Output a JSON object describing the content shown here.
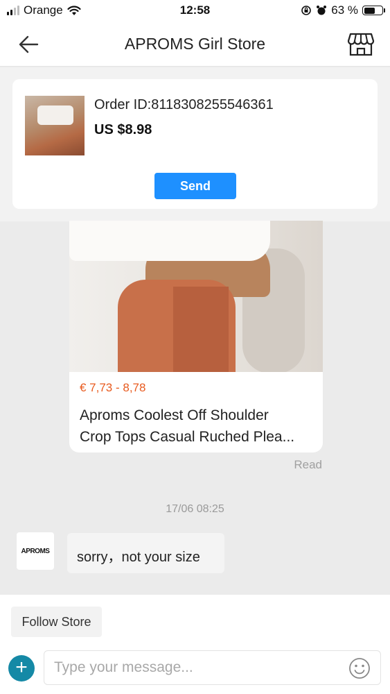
{
  "status_bar": {
    "carrier": "Orange",
    "time": "12:58",
    "battery": "63 %",
    "battery_level": 0.63,
    "icons": [
      "signal-icon",
      "wifi-icon",
      "rotation-lock-icon",
      "alarm-icon",
      "battery-icon"
    ]
  },
  "header": {
    "title": "APROMS Girl Store",
    "icons": [
      "back-arrow-icon",
      "store-icon"
    ]
  },
  "order": {
    "order_id": "Order ID:8118308255546361",
    "price": "US $8.98",
    "send_label": "Send"
  },
  "product": {
    "price_range": "€ 7,73 - 8,78",
    "title_line1": "Aproms Coolest Off Shoulder",
    "title_line2": "Crop Tops Casual Ruched Plea...",
    "status": "Read"
  },
  "chat": {
    "timestamp": "17/06 08:25",
    "avatar_text": "APROMS",
    "message": "sorry，not your size"
  },
  "footer": {
    "follow_label": "Follow Store",
    "plus_icon": "+",
    "input_placeholder": "Type your message...",
    "emoji_icon": "emoji-icon"
  },
  "colors": {
    "accent": "#1e90ff",
    "price_orange": "#e85a1e",
    "plus_teal": "#1589a6"
  }
}
